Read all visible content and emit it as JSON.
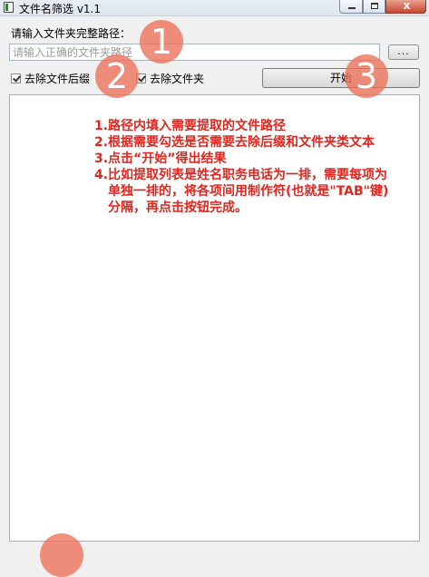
{
  "window": {
    "title": "文件名筛选 v1.1",
    "close_symbol": "x"
  },
  "form": {
    "path_label": "请输入文件夹完整路径：",
    "path_placeholder": "请输入正确的文件夹路径",
    "path_value": "",
    "browse_label": "...",
    "remove_suffix_label": "去除文件后缀",
    "remove_suffix_checked": true,
    "remove_folder_label": "去除文件夹",
    "remove_folder_checked": true,
    "start_label": "开始"
  },
  "instructions": [
    "1.路径内填入需要提取的文件路径",
    "2.根据需要勾选是否需要去除后缀和文件夹类文本",
    "3.点击“开始”得出结果",
    "4.比如提取列表是姓名职务电话为一排，需要每项为",
    "单独一排的，将各项间用制作符(也就是\"TAB\"键)",
    "分隔，再点击按钮完成。"
  ],
  "markers": [
    "1",
    "2",
    "3",
    ""
  ],
  "colors": {
    "instruction_text": "#e0261f",
    "marker_fill": "#ed6f59"
  }
}
